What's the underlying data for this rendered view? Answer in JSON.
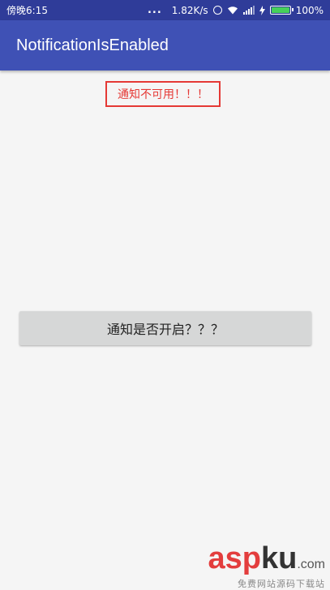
{
  "status_bar": {
    "time": "傍晚6:15",
    "dots": "...",
    "speed": "1.82K/s",
    "battery_percent": "100%",
    "battery_level": 1.0,
    "colors": {
      "background": "#2f3c99",
      "battery": "#46d05a"
    },
    "icons": [
      "alarm-icon",
      "wifi-icon",
      "signal-icon",
      "charging-icon",
      "battery-icon"
    ]
  },
  "app_bar": {
    "title": "NotificationIsEnabled",
    "color": "#3f51b5"
  },
  "main": {
    "notice_text": "通知不可用！！！",
    "notice_color": "#e53935",
    "button_label": "通知是否开启？？？"
  },
  "watermark": {
    "brand": "asp",
    "brand_b": "ku",
    "suffix": ".com",
    "subtitle": "免费网站源码下载站"
  }
}
